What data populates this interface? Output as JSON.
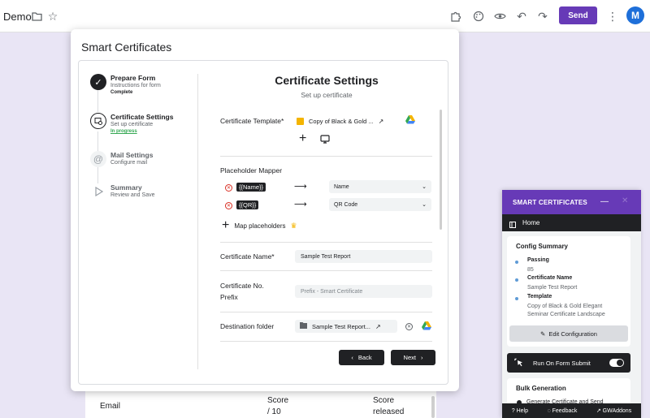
{
  "topbar": {
    "title": "Demo",
    "send_label": "Send",
    "avatar_letter": "M"
  },
  "background_form": {
    "col1": "Email",
    "col2_line1": "Score",
    "col2_line2": "/ 10",
    "col3_line1": "Score",
    "col3_line2": "released"
  },
  "dialog": {
    "title": "Smart Certificates",
    "steps": [
      {
        "title": "Prepare Form",
        "sub": "Instructions for form",
        "status": "Complete"
      },
      {
        "title": "Certificate Settings",
        "sub": "Set up certificate",
        "status": "In progress"
      },
      {
        "title": "Mail Settings",
        "sub": "Configure mail"
      },
      {
        "title": "Summary",
        "sub": "Review and Save"
      }
    ],
    "settings": {
      "title": "Certificate Settings",
      "subtitle": "Set up certificate",
      "template_label": "Certificate Template*",
      "template_value": "Copy of Black & Gold ...",
      "mapper_label": "Placeholder Mapper",
      "mappings": [
        {
          "placeholder": "{{Name}}",
          "value": "Name"
        },
        {
          "placeholder": "{{QR}}",
          "value": "QR Code"
        }
      ],
      "map_placeholders_label": "Map placeholders",
      "name_label": "Certificate Name*",
      "name_value": "Sample Test Report",
      "prefix_label_1": "Certificate No.",
      "prefix_label_2": "Prefix",
      "prefix_placeholder": "Prefix - Smart Certificate",
      "folder_label": "Destination folder",
      "folder_value": "Sample Test Report..."
    },
    "back_label": "Back",
    "next_label": "Next"
  },
  "panel": {
    "title": "SMART CERTIFICATES",
    "nav_home": "Home",
    "config_title": "Config Summary",
    "items": [
      {
        "label": "Passing",
        "value": "85"
      },
      {
        "label": "Certificate Name",
        "value": "Sample Test Report"
      },
      {
        "label": "Template",
        "value": "Copy of Black & Gold Elegant",
        "value2": "Seminar Certificate Landscape"
      }
    ],
    "edit_label": "Edit Configuration",
    "run_label": "Run On Form Submit",
    "run_toggle": true,
    "bulk_title": "Bulk Generation",
    "bulk_item": "Generate Certificate and Send",
    "footer": {
      "help": "Help",
      "feedback": "Feedback",
      "gwaddons": "GWAddons"
    }
  },
  "colors": {
    "accent": "#673ab7",
    "dark": "#202124",
    "remove": "#d93025"
  }
}
